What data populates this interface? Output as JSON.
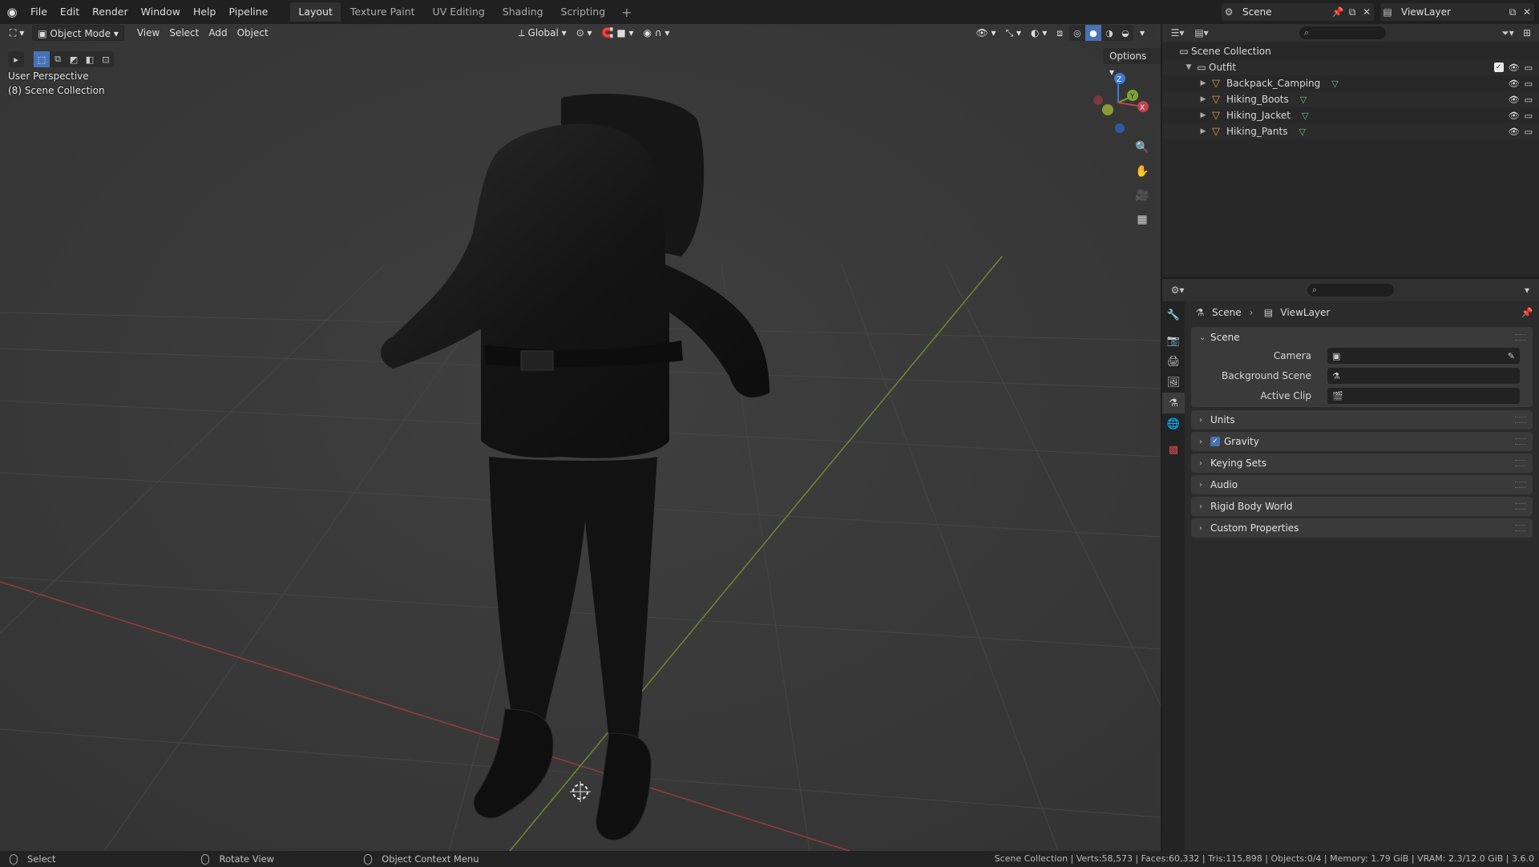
{
  "topbar": {
    "menus": [
      "File",
      "Edit",
      "Render",
      "Window",
      "Help",
      "Pipeline"
    ],
    "workspaces": [
      "Layout",
      "Texture Paint",
      "UV Editing",
      "Shading",
      "Scripting"
    ],
    "active_workspace": "Layout",
    "scene_name": "Scene",
    "view_layer_name": "ViewLayer"
  },
  "viewport": {
    "mode": "Object Mode",
    "menus": [
      "View",
      "Select",
      "Add",
      "Object"
    ],
    "orientation": "Global",
    "options_label": "Options",
    "perspective_label": "User Perspective",
    "collection_label": "(8) Scene Collection",
    "gizmo_axes": {
      "x": "X",
      "y": "Y",
      "z": "Z"
    },
    "colors": {
      "x_axis": "#c4414b",
      "y_axis": "#7fa333",
      "z_axis": "#3f7ad6",
      "background": "#3b3b3b"
    }
  },
  "outliner": {
    "root": "Scene Collection",
    "collection": "Outfit",
    "objects": [
      "Backpack_Camping",
      "Hiking_Boots",
      "Hiking_Jacket",
      "Hiking_Pants"
    ]
  },
  "properties": {
    "breadcrumb_scene": "Scene",
    "breadcrumb_layer": "ViewLayer",
    "panel_title": "Scene",
    "fields": {
      "camera": "Camera",
      "background_scene": "Background Scene",
      "active_clip": "Active Clip"
    },
    "sections": [
      "Units",
      "Gravity",
      "Keying Sets",
      "Audio",
      "Rigid Body World",
      "Custom Properties"
    ],
    "gravity_checked": true
  },
  "statusbar": {
    "select": "Select",
    "rotate": "Rotate View",
    "context": "Object Context Menu",
    "stats": "Scene Collection | Verts:58,573 | Faces:60,332 | Tris:115,898 | Objects:0/4 | Memory: 1.79 GiB | VRAM: 2.3/12.0 GiB | 3.6.0"
  }
}
